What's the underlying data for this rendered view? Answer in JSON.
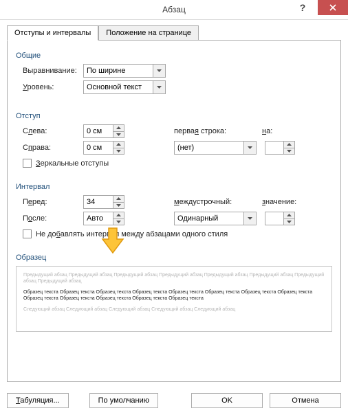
{
  "title": "Абзац",
  "tabs": {
    "indent": "Отступы и интервалы",
    "position": "Положение на странице"
  },
  "general": {
    "title": "Общие",
    "alignmentLabel": "Выравнивание:",
    "alignmentValue": "По ширине",
    "levelLabelPre": "Уровень:",
    "levelValue": "Основной текст"
  },
  "indent": {
    "title": "Отступ",
    "leftPre": "С",
    "leftUL": "л",
    "leftPost": "ева:",
    "leftValue": "0 см",
    "rightPre": "С",
    "rightUL": "п",
    "rightPost": "рава:",
    "rightValue": "0 см",
    "firstLinePre": "перва",
    "firstLineUL": "я",
    "firstLinePost": " строка:",
    "firstLineValue": "(нет)",
    "onUL": "н",
    "onPost": "а:",
    "onValue": "",
    "mirrorUL": "З",
    "mirrorPost": "еркальные отступы"
  },
  "spacing": {
    "title": "Интервал",
    "beforePre": "П",
    "beforeUL": "е",
    "beforePost": "ред:",
    "beforeValue": "34",
    "afterPre": "П",
    "afterUL": "о",
    "afterPost": "сле:",
    "afterValue": "Авто",
    "lineUL": "м",
    "linePost": "еждустрочный:",
    "lineValue": "Одинарный",
    "valueUL": "з",
    "valuePost": "начение:",
    "valueValue": "",
    "dontAddPre": "Не до",
    "dontAddUL": "б",
    "dontAddPost": "авлять интервал между абзацами одного стиля"
  },
  "preview": {
    "title": "Образец",
    "prevLine": "Предыдущий абзац Предыдущий абзац Предыдущий абзац Предыдущий абзац Предыдущий абзац Предыдущий абзац Предыдущий абзац Предыдущий абзац",
    "sampleLine": "Образец текста Образец текста Образец текста Образец текста Образец текста Образец текста Образец текста Образец текста Образец текста Образец текста Образец текста Образец текста Образец текста",
    "nextLine": "Следующий абзац Следующий абзац Следующий абзац Следующий абзац Следующий абзац"
  },
  "buttons": {
    "tabsUL": "Т",
    "tabsPost": "абуляция...",
    "default": "По умолчанию",
    "ok": "OK",
    "cancel": "Отмена"
  }
}
